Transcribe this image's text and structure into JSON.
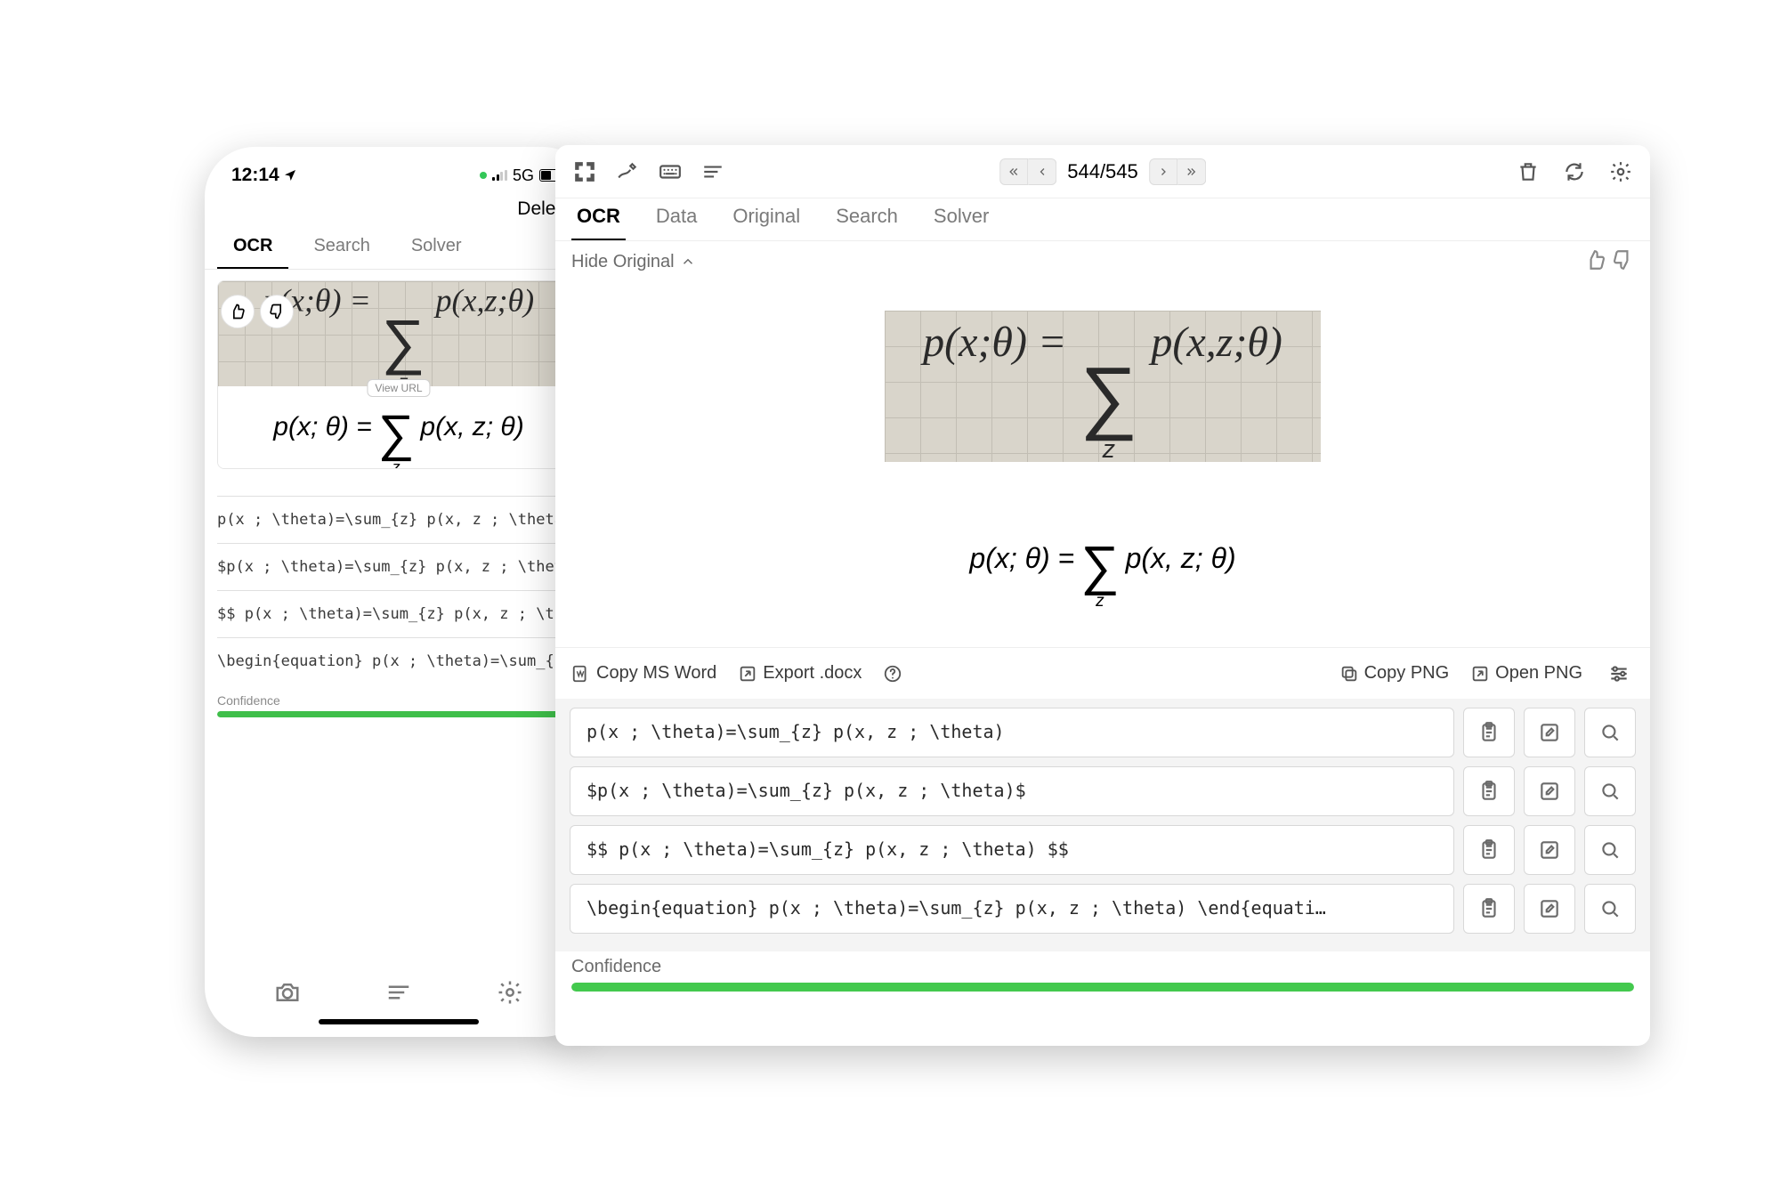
{
  "phone": {
    "status": {
      "time": "12:14",
      "net_label": "5G"
    },
    "delete_label": "Delete",
    "tabs": [
      "OCR",
      "Search",
      "Solver"
    ],
    "active_tab": 0,
    "view_url_label": "View URL",
    "handwritten_approx": "p(x;θ) = Σ_z p(x,z;θ)",
    "rendered": {
      "lhs": "p(x; θ) = ",
      "sum_sub": "z",
      "rhs": "p(x, z; θ)"
    },
    "outputs": [
      "p(x ; \\theta)=\\sum_{z} p(x, z ; \\theta)",
      "$p(x ; \\theta)=\\sum_{z} p(x, z ; \\theta)$",
      "$$ p(x ; \\theta)=\\sum_{z} p(x, z ; \\theta)…",
      "\\begin{equation} p(x ; \\theta)=\\sum_{z} p(…"
    ],
    "confidence": {
      "label": "Confidence",
      "value_pct": 100
    }
  },
  "desk": {
    "pager": {
      "label": "544/545"
    },
    "tabs": [
      "OCR",
      "Data",
      "Original",
      "Search",
      "Solver"
    ],
    "active_tab": 0,
    "hide_original_label": "Hide Original",
    "handwritten_approx": "p(x;θ) = Σ_z p(x,z;θ)",
    "rendered": {
      "lhs": "p(x; θ) = ",
      "sum_sub": "z",
      "rhs": "p(x, z; θ)"
    },
    "actions": {
      "copy_word": "Copy MS Word",
      "export_docx": "Export .docx",
      "copy_png": "Copy PNG",
      "open_png": "Open PNG"
    },
    "outputs": [
      "p(x ; \\theta)=\\sum_{z} p(x, z ; \\theta)",
      "$p(x ; \\theta)=\\sum_{z} p(x, z ; \\theta)$",
      "$$ p(x ; \\theta)=\\sum_{z} p(x, z ; \\theta) $$",
      "\\begin{equation} p(x ; \\theta)=\\sum_{z} p(x, z ; \\theta) \\end{equati…"
    ],
    "confidence": {
      "label": "Confidence",
      "value_pct": 100
    }
  }
}
